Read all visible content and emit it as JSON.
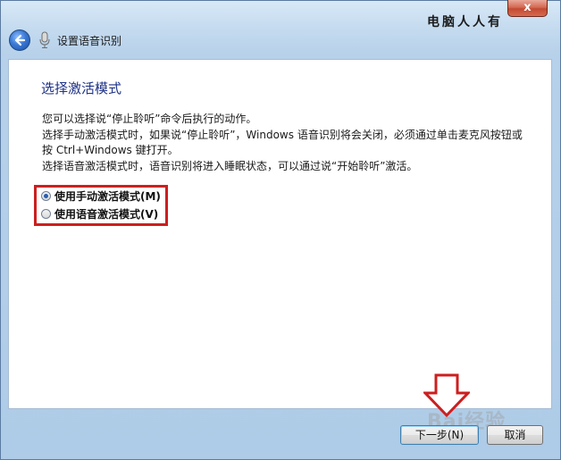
{
  "window": {
    "title": "设置语音识别",
    "close_glyph": "x",
    "watermark_text": "电脑人人有"
  },
  "page": {
    "heading": "选择激活模式",
    "description_lines": [
      "您可以选择说“停止聆听”命令后执行的动作。",
      "选择手动激活模式时，如果说“停止聆听”，Windows 语音识别将会关闭，必须通过单击麦克风按钮或",
      "按 Ctrl+Windows 键打开。",
      "选择语音激活模式时，语音识别将进入睡眠状态，可以通过说“开始聆听”激活。"
    ]
  },
  "options": [
    {
      "label": "使用手动激活模式(M)",
      "checked": true
    },
    {
      "label": "使用语音激活模式(V)",
      "checked": false
    }
  ],
  "buttons": {
    "next": "下一步(N)",
    "cancel": "取消"
  },
  "annotations": {
    "highlight_color": "#cc1f1f",
    "arrow_color": "#cc1f1f",
    "baidu_watermark": "Bai经验"
  },
  "icons": {
    "back": "back-arrow-icon",
    "mic": "microphone-icon",
    "close": "close-icon"
  }
}
